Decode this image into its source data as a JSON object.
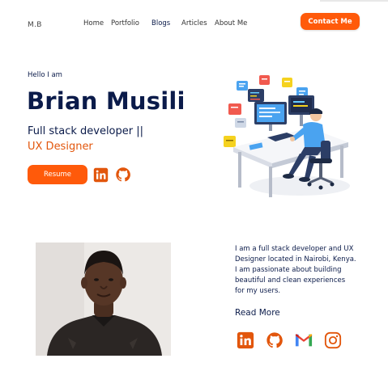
{
  "nav": {
    "logo": "M.B",
    "links": [
      "Home",
      "Portfolio",
      "Blogs",
      "Articles",
      "About Me"
    ],
    "contact_label": "Contact Me"
  },
  "hero": {
    "greeting": "Hello I am",
    "name": "Brian Musili",
    "role_line1": "Full stack developer ||",
    "role_line2": "UX Designer",
    "resume_label": "Resume",
    "icons": [
      "linkedin-icon",
      "github-icon"
    ]
  },
  "about": {
    "text": "I am a full stack developer and UX Designer located in Nairobi, Kenya. I am passionate about building beautiful and clean experiences for my users.",
    "read_more": "Read More",
    "social_icons": [
      "linkedin-icon",
      "github-icon",
      "gmail-icon",
      "instagram-icon"
    ]
  },
  "colors": {
    "accent": "#ff5a0a",
    "navy": "#0b1b4a",
    "orange_text": "#e2560c"
  }
}
